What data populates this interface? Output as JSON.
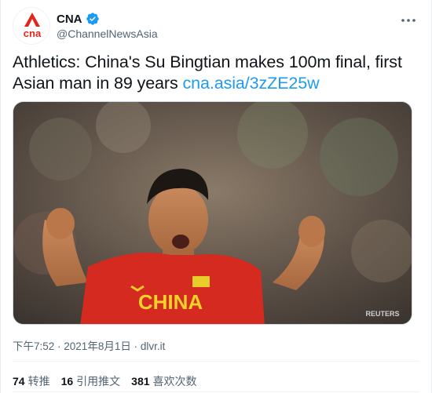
{
  "account": {
    "display_name": "CNA",
    "handle": "@ChannelNewsAsia",
    "logo_text": "cna",
    "brand_color": "#e1261c",
    "verified_icon": "verified-badge-icon"
  },
  "tweet": {
    "text": "Athletics: China's Su Bingtian makes 100m final, first Asian man in 89 years ",
    "link_text": "cna.asia/3zZE25w",
    "link_color": "#1d9bf0"
  },
  "media": {
    "description_icon": "photo-sprinter",
    "jersey_text": "CHINA",
    "watermark": "REUTERS"
  },
  "meta": {
    "time": "下午7:52",
    "separator": " · ",
    "date": "2021年8月1日",
    "source": "dlvr.it"
  },
  "stats": {
    "retweets_count": "74",
    "retweets_label": "转推",
    "quotes_count": "16",
    "quotes_label": "引用推文",
    "likes_count": "381",
    "likes_label": "喜欢次数"
  },
  "icons": {
    "more": "more-horizontal-icon"
  }
}
